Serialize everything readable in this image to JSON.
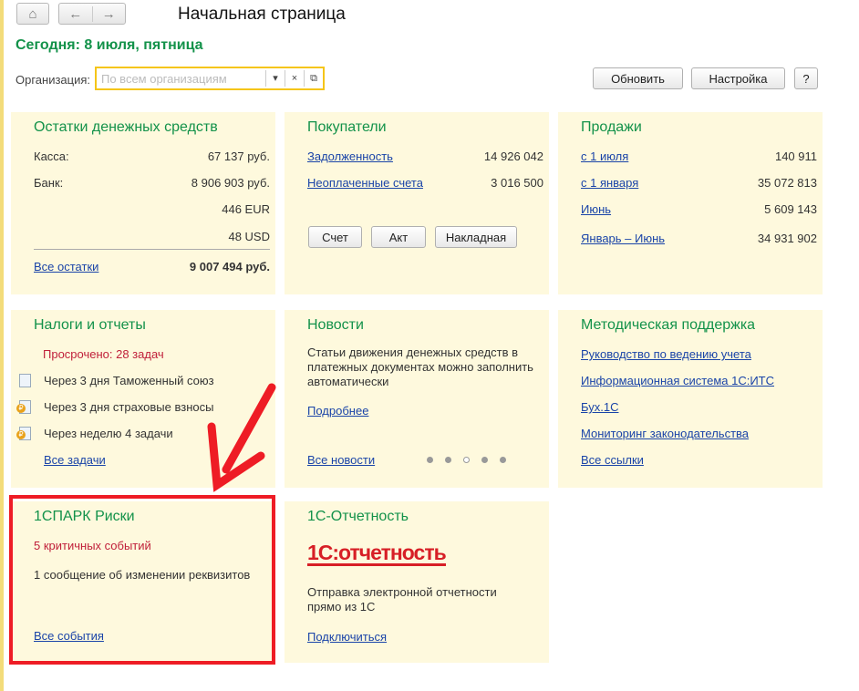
{
  "header": {
    "title": "Начальная страница",
    "today": "Сегодня: 8 июля, пятница",
    "org_label": "Организация:",
    "org_placeholder": "По всем организациям",
    "refresh": "Обновить",
    "settings": "Настройка",
    "help": "?"
  },
  "cash": {
    "title": "Остатки денежных средств",
    "kassa_label": "Касса:",
    "kassa": "67 137 руб.",
    "bank_label": "Банк:",
    "bank": "8 906 903 руб.",
    "eur": "446 EUR",
    "usd": "48 USD",
    "all": "Все остатки",
    "total": "9 007 494 руб."
  },
  "buyers": {
    "title": "Покупатели",
    "debt_label": "Задолженность",
    "debt": "14 926 042",
    "unpaid_label": "Неоплаченные счета",
    "unpaid": "3 016 500",
    "b1": "Счет",
    "b2": "Акт",
    "b3": "Накладная"
  },
  "sales": {
    "title": "Продажи",
    "rows": [
      {
        "l": "с 1 июля",
        "v": "140 911"
      },
      {
        "l": "с 1 января",
        "v": "35 072 813"
      },
      {
        "l": "Июнь",
        "v": "5 609 143"
      },
      {
        "l": "Январь – Июнь",
        "v": "34 931 902"
      }
    ]
  },
  "taxes": {
    "title": "Налоги и отчеты",
    "overdue": "Просрочено: 28 задач",
    "items": [
      "Через 3 дня Таможенный союз",
      "Через 3 дня страховые взносы",
      "Через неделю 4 задачи"
    ],
    "all": "Все задачи"
  },
  "news": {
    "title": "Новости",
    "text": "Статьи движения денежных средств в платежных документах можно заполнить автоматически",
    "more": "Подробнее",
    "all": "Все новости"
  },
  "support": {
    "title": "Методическая поддержка",
    "links": [
      "Руководство по ведению учета",
      "Информационная система 1С:ИТС",
      "Бух.1С",
      "Мониторинг законодательства"
    ],
    "all": "Все ссылки"
  },
  "spark": {
    "title": "1СПАРК Риски",
    "critical": "5 критичных событий",
    "msg": "1 сообщение об изменении реквизитов",
    "all": "Все события"
  },
  "report": {
    "title": "1С-Отчетность",
    "logo": "1С:отчетность",
    "text": "Отправка электронной отчетности прямо из 1С",
    "connect": "Подключиться"
  }
}
